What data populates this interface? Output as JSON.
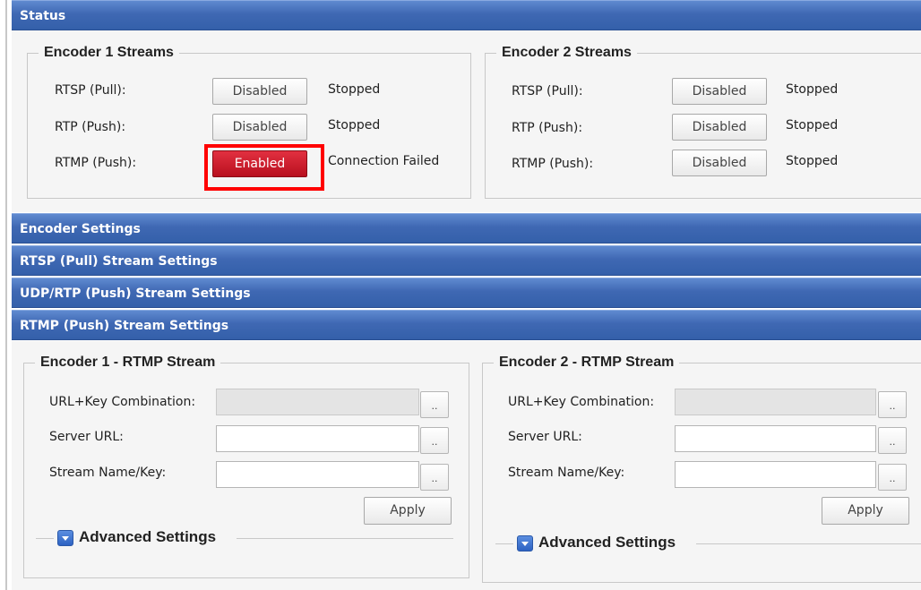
{
  "sections": {
    "status": "Status",
    "encoder_settings": "Encoder Settings",
    "rtsp_pull": "RTSP (Pull) Stream Settings",
    "udp_rtp_push": "UDP/RTP (Push) Stream Settings",
    "rtmp_push": "RTMP (Push) Stream Settings"
  },
  "encoder1_streams": {
    "legend": "Encoder 1 Streams",
    "rows": [
      {
        "label": "RTSP (Pull):",
        "button": "Disabled",
        "status": "Stopped"
      },
      {
        "label": "RTP (Push):",
        "button": "Disabled",
        "status": "Stopped"
      },
      {
        "label": "RTMP (Push):",
        "button": "Enabled",
        "status": "Connection Failed"
      }
    ]
  },
  "encoder2_streams": {
    "legend": "Encoder 2 Streams",
    "rows": [
      {
        "label": "RTSP (Pull):",
        "button": "Disabled",
        "status": "Stopped"
      },
      {
        "label": "RTP (Push):",
        "button": "Disabled",
        "status": "Stopped"
      },
      {
        "label": "RTMP (Push):",
        "button": "Disabled",
        "status": "Stopped"
      }
    ]
  },
  "encoder1_rtmp": {
    "legend": "Encoder 1 - RTMP Stream",
    "url_key_label": "URL+Key Combination:",
    "server_url_label": "Server URL:",
    "stream_key_label": "Stream Name/Key:",
    "browse": "..",
    "apply": "Apply",
    "advanced": "Advanced Settings",
    "url_key_value": "",
    "server_url_value": "",
    "stream_key_value": ""
  },
  "encoder2_rtmp": {
    "legend": "Encoder 2 - RTMP Stream",
    "url_key_label": "URL+Key Combination:",
    "server_url_label": "Server URL:",
    "stream_key_label": "Stream Name/Key:",
    "browse": "..",
    "apply": "Apply",
    "advanced": "Advanced Settings",
    "url_key_value": "",
    "server_url_value": "",
    "stream_key_value": ""
  },
  "colors": {
    "header_blue": "#3f68b3",
    "enabled_red": "#c8182a",
    "highlight_red": "#ff0000"
  }
}
